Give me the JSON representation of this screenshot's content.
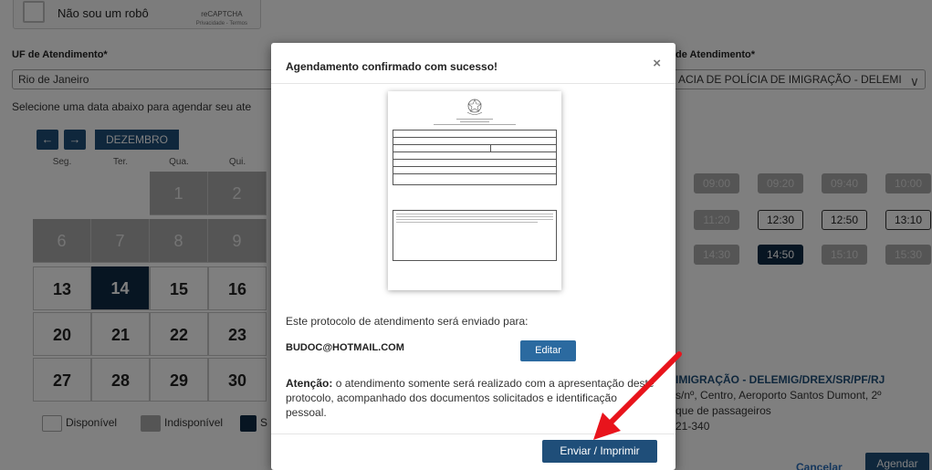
{
  "captcha": {
    "label": "Não sou um robô",
    "brand": "reCAPTCHA",
    "terms": "Privacidade - Termos"
  },
  "form": {
    "uf_label": "UF de Atendimento*",
    "uf_value": "Rio de Janeiro",
    "unit_label": "de Atendimento*",
    "unit_value": "ACIA DE POLÍCIA DE IMIGRAÇÃO - DELEMI",
    "instruction": "Selecione uma data abaixo para agendar seu ate"
  },
  "calendar": {
    "month": "DEZEMBRO",
    "weekdays": [
      "Seg.",
      "Ter.",
      "Qua.",
      "Qui."
    ],
    "row1": [
      "1",
      "2"
    ],
    "row2": [
      "6",
      "7",
      "8",
      "9"
    ],
    "row3": [
      "13",
      "14",
      "15",
      "16"
    ],
    "row4": [
      "20",
      "21",
      "22",
      "23"
    ],
    "row5": [
      "27",
      "28",
      "29",
      "30"
    ],
    "selected_day": "14"
  },
  "legend": {
    "available": "Disponível",
    "unavailable": "Indisponível",
    "selected_partial": "S"
  },
  "times": {
    "row1": [
      "09:00",
      "09:20",
      "09:40",
      "10:00"
    ],
    "row2": [
      "11:20",
      "12:30",
      "12:50",
      "13:10"
    ],
    "row3": [
      "14:30",
      "14:50",
      "15:10",
      "15:30"
    ],
    "selected": "14:50"
  },
  "office": {
    "name": "IMIGRAÇÃO - DELEMIG/DREX/SR/PF/RJ",
    "line1": "s/nº, Centro, Aeroporto Santos Dumont, 2º",
    "line2": "que de passageiros",
    "line3": "21-340"
  },
  "actions": {
    "cancel": "Cancelar",
    "schedule": "Agendar"
  },
  "modal": {
    "title": "Agendamento confirmado com sucesso!",
    "close": "×",
    "protocol_text": "Este protocolo de atendimento será enviado para:",
    "email": "BUDOC@HOTMAIL.COM",
    "edit_button": "Editar",
    "warning_bold": "Atenção:",
    "warning_text": "o atendimento somente será realizado com a apresentação deste protocolo, acompanhado dos documentos solicitados e identificação pessoal.",
    "send_button": "Enviar / Imprimir"
  },
  "colors": {
    "primary": "#1f4e79",
    "selected": "#0e2a44",
    "unavailable": "#ababab",
    "arrow": "#e8141c"
  }
}
